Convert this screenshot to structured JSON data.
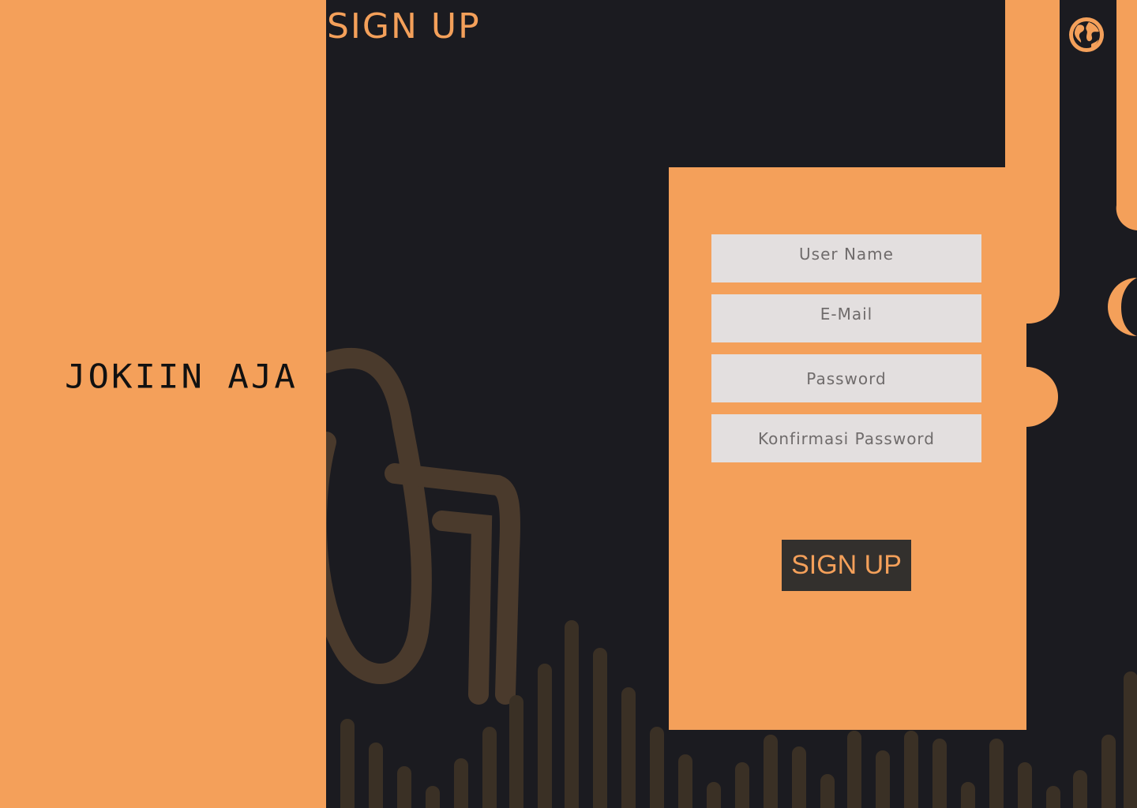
{
  "app": {
    "brand": "JOKIIN AJA",
    "page_title": "SIGN UP"
  },
  "header": {
    "language_icon": "globe-icon"
  },
  "form": {
    "username_placeholder": "User Name",
    "email_placeholder": "E-Mail",
    "password_placeholder": "Password",
    "confirm_password_placeholder": "Konfirmasi Password",
    "submit_label": "SIGN UP"
  },
  "colors": {
    "accent": "#f4a05a",
    "background": "#1b1b20",
    "input_bg": "#e3dfdf",
    "button_bg": "#33302d",
    "placeholder": "#6f6b6b"
  }
}
